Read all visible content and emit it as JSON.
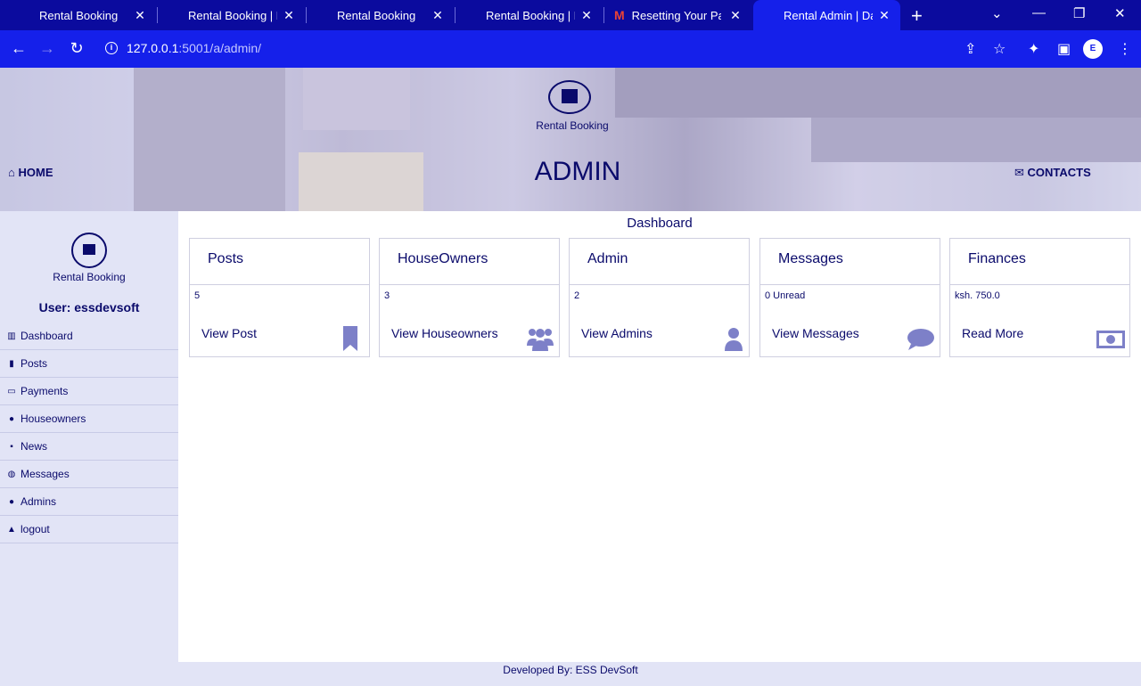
{
  "browser": {
    "tabs": [
      {
        "title": "Rental Booking"
      },
      {
        "title": "Rental Booking | Po"
      },
      {
        "title": "Rental Booking"
      },
      {
        "title": "Rental Booking | H"
      },
      {
        "title": "Resetting Your Pas"
      },
      {
        "title": "Rental Admin | Das"
      }
    ],
    "url_host": "127.0.0.1",
    "url_path": ":5001/a/admin/"
  },
  "header": {
    "logo_label": "Rental Booking",
    "home": "HOME",
    "title": "ADMIN",
    "contacts": "CONTACTS"
  },
  "sidebar": {
    "logo_label": "Rental Booking",
    "user": "User: essdevsoft",
    "items": [
      {
        "label": "Dashboard",
        "icon": "bar-chart-icon"
      },
      {
        "label": "Posts",
        "icon": "bookmark-icon"
      },
      {
        "label": "Payments",
        "icon": "money-icon"
      },
      {
        "label": "Houseowners",
        "icon": "users-icon"
      },
      {
        "label": "News",
        "icon": "news-icon"
      },
      {
        "label": "Messages",
        "icon": "chat-icon"
      },
      {
        "label": "Admins",
        "icon": "user-icon"
      },
      {
        "label": "logout",
        "icon": "lock-icon"
      }
    ]
  },
  "main": {
    "title": "Dashboard",
    "cards": [
      {
        "title": "Posts",
        "count": "5",
        "link": "View Post",
        "icon": "bookmark-icon"
      },
      {
        "title": "HouseOwners",
        "count": "3",
        "link": "View Houseowners",
        "icon": "users-icon"
      },
      {
        "title": "Admin",
        "count": "2",
        "link": "View Admins",
        "icon": "user-icon"
      },
      {
        "title": "Messages",
        "count": "0 Unread",
        "link": "View Messages",
        "icon": "comment-icon"
      },
      {
        "title": "Finances",
        "count": "ksh. 750.0",
        "link": "Read More",
        "icon": "money-icon"
      }
    ]
  },
  "footer": {
    "text": "Developed By: ESS DevSoft"
  },
  "colors": {
    "accent": "#0a0a6b",
    "chrome": "#1520ea",
    "icon": "#7d80c8",
    "sidebar": "#e2e4f6"
  }
}
